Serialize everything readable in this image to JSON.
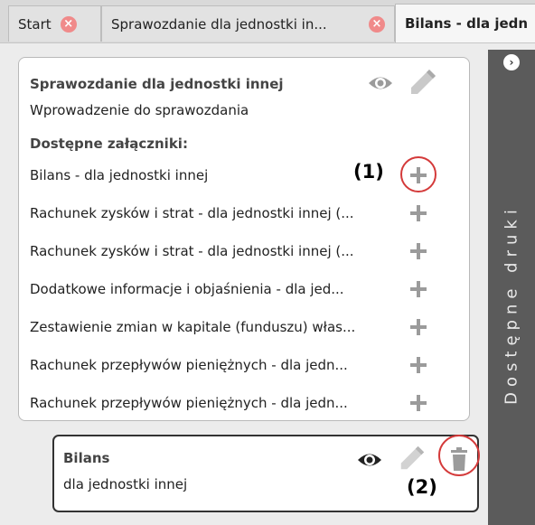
{
  "tabs": [
    {
      "label": "Start",
      "close_icon": "×"
    },
    {
      "label": "Sprawozdanie dla jednostki in...",
      "close_icon": "×"
    },
    {
      "label": "Bilans - dla jedn"
    }
  ],
  "panel": {
    "title": "Sprawozdanie dla jednostki innej",
    "subtitle": "Wprowadzenie do sprawozdania",
    "attachments_heading": "Dostępne załączniki:",
    "attachments": [
      "Bilans - dla jednostki innej",
      "Rachunek zysków i strat - dla jednostki innej (...",
      "Rachunek zysków i strat - dla jednostki innej (...",
      "Dodatkowe informacje i objaśnienia - dla jed...",
      "Zestawienie zmian w kapitale (funduszu) włas...",
      "Rachunek przepływów pieniężnych - dla jedn...",
      "Rachunek przepływów pieniężnych - dla jedn..."
    ],
    "callout_1": "(1)"
  },
  "sidebar": {
    "toggle_icon": "›",
    "label": "Dostępne druki"
  },
  "card": {
    "title": "Bilans",
    "subtitle": "dla jednostki innej",
    "callout_2": "(2)"
  },
  "colors": {
    "accent_red": "#d43a3a",
    "sidebar_bg": "#5b5b5b",
    "icon_gray": "#9b9b9b"
  }
}
